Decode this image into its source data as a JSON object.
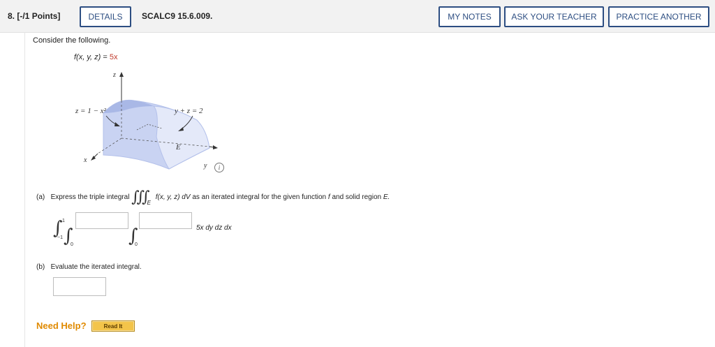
{
  "header": {
    "question_number": "8.",
    "points": "[-/1 Points]",
    "details_label": "DETAILS",
    "assignment_id": "SCALC9 15.6.009.",
    "my_notes_label": "MY NOTES",
    "ask_teacher_label": "ASK YOUR TEACHER",
    "practice_another_label": "PRACTICE ANOTHER"
  },
  "problem": {
    "intro": "Consider the following.",
    "function_lhs": "f(x, y, z)",
    "function_eq": " = ",
    "function_rhs": "5x"
  },
  "figure": {
    "z_axis_label": "z",
    "x_axis_label": "x",
    "y_axis_label": "y",
    "surface_label_1": "z = 1 − x²",
    "surface_label_2": "y + z = 2",
    "region_label": "E",
    "info_icon": "i",
    "colors": {
      "region_fill": "#c9d3f2",
      "region_dark": "#a9b8e6",
      "region_light": "#e4e9f9"
    }
  },
  "part_a": {
    "label": "(a)",
    "text": "Express the triple integral",
    "integral_symbol": "∫∫∫",
    "region_subscript": "E",
    "integrand": "f(x, y, z) dV",
    "text_after": "as an iterated integral for the given function",
    "f_symbol": "f",
    "text_and": "and solid region",
    "E_symbol": "E.",
    "outer_upper": "1",
    "outer_lower": "−1",
    "middle_lower": "0",
    "inner_lower": "0",
    "middle_upper_value": "",
    "inner_upper_value": "",
    "iterated_integrand": "5x dy dz dx"
  },
  "part_b": {
    "label": "(b)",
    "text": "Evaluate the iterated integral.",
    "answer_value": ""
  },
  "help": {
    "need_help_label": "Need Help?",
    "read_it_label": "Read It"
  }
}
